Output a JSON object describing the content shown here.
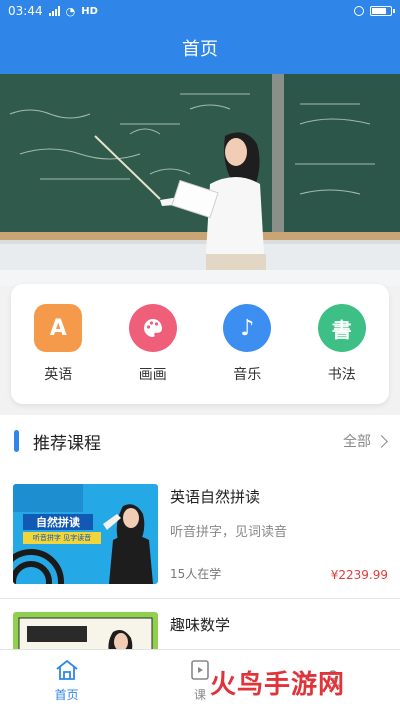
{
  "status": {
    "time": "03:44",
    "network": "HD"
  },
  "header": {
    "title": "首页"
  },
  "categories": [
    {
      "label": "英语",
      "icon": "english-book-icon",
      "color": "#f49a4a",
      "glyph": "A"
    },
    {
      "label": "画画",
      "icon": "palette-icon",
      "color": "#ef5f7a",
      "glyph": "🎨"
    },
    {
      "label": "音乐",
      "icon": "music-note-icon",
      "color": "#3c8ef0",
      "glyph": "♪"
    },
    {
      "label": "书法",
      "icon": "calligraphy-icon",
      "color": "#3dbf86",
      "glyph": "書"
    }
  ],
  "section": {
    "title": "推荐课程",
    "more": "全部"
  },
  "courses": [
    {
      "name": "英语自然拼读",
      "desc": "听音拼字，见词读音",
      "count": "15人在学",
      "price": "¥2239.99",
      "thumb_title": "自然拼读",
      "thumb_sub": "听音拼字  见字读音"
    },
    {
      "name": "趣味数学",
      "desc": "",
      "count": "",
      "price": "",
      "thumb_title": "",
      "thumb_sub": ""
    }
  ],
  "tabs": [
    {
      "label": "首页",
      "icon": "home-icon",
      "active": true
    },
    {
      "label": "课",
      "icon": "course-icon",
      "active": false
    },
    {
      "label": "",
      "icon": "profile-icon",
      "active": false
    }
  ],
  "watermark": {
    "text": "火鸟手游网"
  }
}
